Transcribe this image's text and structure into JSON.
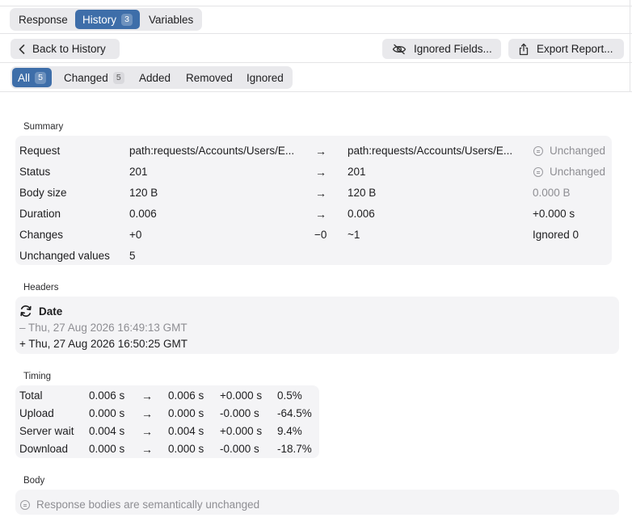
{
  "top_tabs": [
    {
      "label": "Response",
      "badge": null,
      "active": false
    },
    {
      "label": "History",
      "badge": "3",
      "active": true
    },
    {
      "label": "Variables",
      "badge": null,
      "active": false
    }
  ],
  "toolbar": {
    "back_label": "Back to History",
    "ignored_fields_label": "Ignored Fields...",
    "export_label": "Export Report..."
  },
  "filter_tabs": [
    {
      "label": "All",
      "badge": "5",
      "active": true
    },
    {
      "label": "Changed",
      "badge": "5",
      "active": false
    },
    {
      "label": "Added",
      "badge": null,
      "active": false
    },
    {
      "label": "Removed",
      "badge": null,
      "active": false
    },
    {
      "label": "Ignored",
      "badge": null,
      "active": false
    }
  ],
  "summary": {
    "title": "Summary",
    "rows": [
      {
        "label": "Request",
        "left": "path:requests/Accounts/Users/E...",
        "arrow": "→",
        "right": "path:requests/Accounts/Users/E...",
        "status": "Unchanged",
        "status_icon": "equals-circle-icon"
      },
      {
        "label": "Status",
        "left": "201",
        "arrow": "→",
        "right": "201",
        "status": "Unchanged",
        "status_icon": "equals-circle-icon"
      },
      {
        "label": "Body size",
        "left": "120 B",
        "arrow": "→",
        "right": "120 B",
        "status": "0.000 B",
        "status_icon": null
      },
      {
        "label": "Duration",
        "left": "0.006",
        "arrow": "→",
        "right": "0.006",
        "status": "+0.000 s",
        "status_icon": null
      },
      {
        "label": "Changes",
        "left": "+0",
        "arrow": "−0",
        "right": "~1",
        "status": "Ignored 0",
        "status_icon": null
      },
      {
        "label": "Unchanged values",
        "left": "5",
        "arrow": "",
        "right": "",
        "status": "",
        "status_icon": null
      }
    ]
  },
  "headers": {
    "title": "Headers",
    "name": "Date",
    "icon": "refresh-icon",
    "old": "– Thu, 27 Aug 2026 16:49:13 GMT",
    "new": "+ Thu, 27 Aug 2026 16:50:25 GMT"
  },
  "timing": {
    "title": "Timing",
    "rows": [
      {
        "label": "Total",
        "before": "0.006 s",
        "arrow": "→",
        "after": "0.006 s",
        "delta": "+0.000 s",
        "pct": "0.5%"
      },
      {
        "label": "Upload",
        "before": "0.000 s",
        "arrow": "→",
        "after": "0.000 s",
        "delta": "-0.000 s",
        "pct": "-64.5%"
      },
      {
        "label": "Server wait",
        "before": "0.004 s",
        "arrow": "→",
        "after": "0.004 s",
        "delta": "+0.000 s",
        "pct": "9.4%"
      },
      {
        "label": "Download",
        "before": "0.000 s",
        "arrow": "→",
        "after": "0.000 s",
        "delta": "-0.000 s",
        "pct": "-18.7%"
      }
    ]
  },
  "body": {
    "title": "Body",
    "message": "Response bodies are semantically unchanged",
    "icon": "equals-circle-icon"
  }
}
